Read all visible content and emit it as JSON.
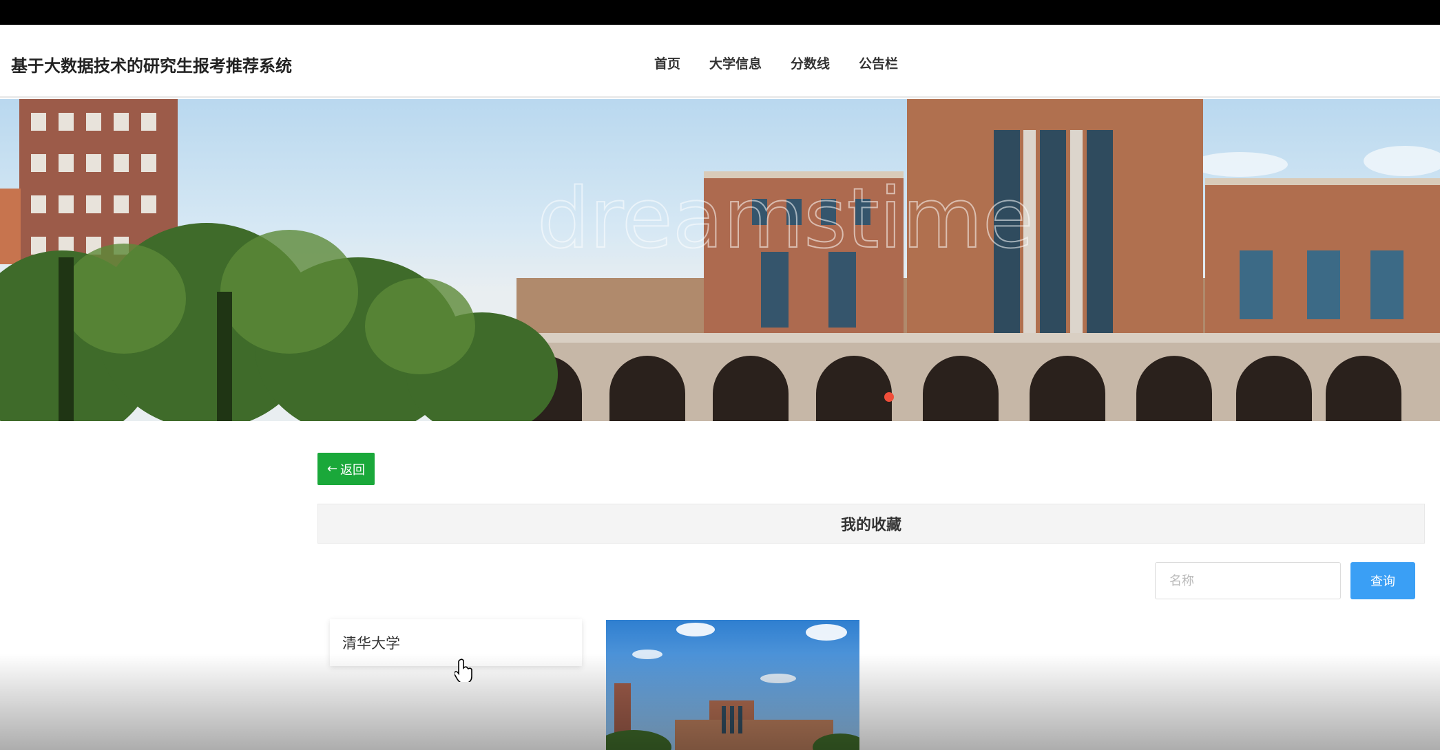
{
  "header": {
    "site_title": "基于大数据技术的研究生报考推荐系统",
    "nav": [
      {
        "label": "首页"
      },
      {
        "label": "大学信息"
      },
      {
        "label": "分数线"
      },
      {
        "label": "公告栏"
      }
    ]
  },
  "banner": {
    "watermark_text": "dreamstime"
  },
  "actions": {
    "back_label": "返回",
    "back_icon": "arrow-left-icon"
  },
  "section": {
    "title": "我的收藏"
  },
  "search": {
    "placeholder": "名称",
    "button_label": "查询"
  },
  "favorites": [
    {
      "name": "清华大学"
    }
  ],
  "colors": {
    "back_button": "#1aa83a",
    "search_button": "#3a9ff5",
    "topbar": "#000000"
  }
}
